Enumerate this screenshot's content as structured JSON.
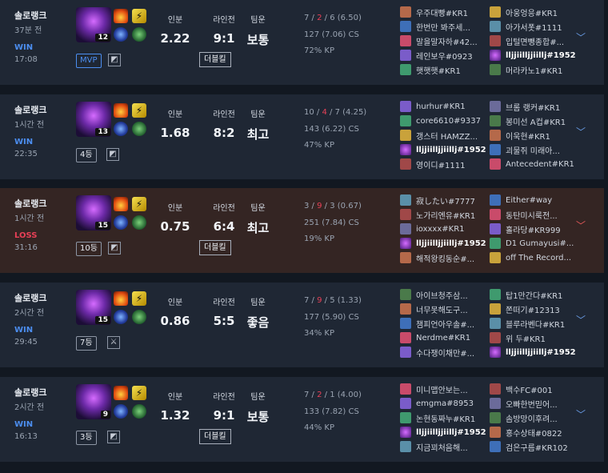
{
  "games": [
    {
      "mode": "솔로랭크",
      "ago": "37분 전",
      "result": "WIN",
      "duration": "17:08",
      "champ_level": "12",
      "badge": "MVP",
      "mvp": true,
      "spells": [
        "ignite-icon",
        "flash-icon"
      ],
      "runes": [
        "dark-harvest-icon",
        "resolve-icon"
      ],
      "labels": {
        "mk": "인분",
        "lane": "라인전",
        "team": "팀운"
      },
      "mk": "2.22",
      "lane": "9:1",
      "team": "보통",
      "tag": "더블킬",
      "kda": {
        "k": "7",
        "d": "2",
        "a": "6",
        "ratio": "(6.50)"
      },
      "cs": "127 (7.06) CS",
      "kp": "72% KP",
      "team1": [
        "우주대빵#KR1",
        "한번만 봐주세...",
        "말을말자하#42...",
        "레인보우#0923",
        "햇햇햇#KR1"
      ],
      "team2": [
        "아웅엉응#KR1",
        "아가서폿#1111",
        "입털면뺑종합#...",
        "lljjiilljjiillj#1952",
        "머라카노1#KR1"
      ],
      "me_team": 2,
      "me_index": 3
    },
    {
      "mode": "솔로랭크",
      "ago": "1시간 전",
      "result": "WIN",
      "duration": "22:35",
      "champ_level": "13",
      "badge": "4등",
      "mvp": false,
      "spells": [
        "ignite-icon",
        "flash-icon"
      ],
      "runes": [
        "dark-harvest-icon",
        "resolve-icon"
      ],
      "labels": {
        "mk": "인분",
        "lane": "라인전",
        "team": "팀운"
      },
      "mk": "1.68",
      "lane": "8:2",
      "team": "최고",
      "tag": "",
      "kda": {
        "k": "10",
        "d": "4",
        "a": "7",
        "ratio": "(4.25)"
      },
      "cs": "143 (6.22) CS",
      "kp": "47% KP",
      "team1": [
        "hurhur#KR1",
        "core6610#9337",
        "갱스터 HAMZZ...",
        "lljjiilljjiillj#1952",
        "영이디#1111"
      ],
      "team2": [
        "브롬 랭커#KR1",
        "봉미선 A컵#KR1",
        "이욱현#KR1",
        "괴물쥐 미래아...",
        "Antecedent#KR1"
      ],
      "me_team": 1,
      "me_index": 3
    },
    {
      "mode": "솔로랭크",
      "ago": "1시간 전",
      "result": "LOSS",
      "duration": "31:16",
      "champ_level": "15",
      "badge": "10등",
      "mvp": false,
      "spells": [
        "ignite-icon",
        "flash-icon"
      ],
      "runes": [
        "dark-harvest-icon",
        "resolve-icon"
      ],
      "labels": {
        "mk": "인분",
        "lane": "라인전",
        "team": "팀운"
      },
      "mk": "0.75",
      "lane": "6:4",
      "team": "최고",
      "tag": "더블킬",
      "kda": {
        "k": "3",
        "d": "9",
        "a": "3",
        "ratio": "(0.67)"
      },
      "cs": "251 (7.84) CS",
      "kp": "19% KP",
      "team1": [
        "寂したい#7777",
        "노가리엔유#KR1",
        "ioxxxx#KR1",
        "lljjiilljjiillj#1952",
        "해적왕킹동순#..."
      ],
      "team2": [
        "Either#way",
        "동탄미시룩전...",
        "홀라당#KR999",
        "D1 Gumayusi#...",
        "off The Record..."
      ],
      "me_team": 1,
      "me_index": 3
    },
    {
      "mode": "솔로랭크",
      "ago": "2시간 전",
      "result": "WIN",
      "duration": "29:45",
      "champ_level": "15",
      "badge": "7등",
      "mvp": false,
      "spells": [
        "ignite-icon",
        "flash-icon"
      ],
      "runes": [
        "dark-harvest-icon",
        "resolve-icon"
      ],
      "labels": {
        "mk": "인분",
        "lane": "라인전",
        "team": "팀운"
      },
      "mk": "0.86",
      "lane": "5:5",
      "team": "좋음",
      "tag": "",
      "kda": {
        "k": "7",
        "d": "9",
        "a": "5",
        "ratio": "(1.33)"
      },
      "cs": "177 (5.90) CS",
      "kp": "34% KP",
      "team1": [
        "아이브청주삼...",
        "너무못해도구...",
        "챔피언아우솔#...",
        "Nerdme#KR1",
        "수다쟁이채만#..."
      ],
      "team2": [
        "탑1만간다#KR1",
        "쫀떠기#12313",
        "블루라벤다#KR1",
        "위 두#KR1",
        "lljjiilljjiillj#1952"
      ],
      "me_team": 2,
      "me_index": 4
    },
    {
      "mode": "솔로랭크",
      "ago": "2시간 전",
      "result": "WIN",
      "duration": "16:13",
      "champ_level": "9",
      "badge": "3등",
      "mvp": false,
      "spells": [
        "ignite-icon",
        "flash-icon"
      ],
      "runes": [
        "dark-harvest-icon",
        "resolve-icon"
      ],
      "labels": {
        "mk": "인분",
        "lane": "라인전",
        "team": "팀운"
      },
      "mk": "1.32",
      "lane": "9:1",
      "team": "보통",
      "tag": "더블킬",
      "kda": {
        "k": "7",
        "d": "2",
        "a": "1",
        "ratio": "(4.00)"
      },
      "cs": "133 (7.82) CS",
      "kp": "44% KP",
      "team1": [
        "미니맵안보는...",
        "emgma#8953",
        "논현동짜누#KR1",
        "lljjiilljjiillj#1952",
        "지금꾀처음해..."
      ],
      "team2": [
        "백수FC#001",
        "오빠한번믿어...",
        "솜방망이후려...",
        "홍수상태#0822",
        "검은구름#KR102"
      ],
      "me_team": 1,
      "me_index": 3
    }
  ]
}
